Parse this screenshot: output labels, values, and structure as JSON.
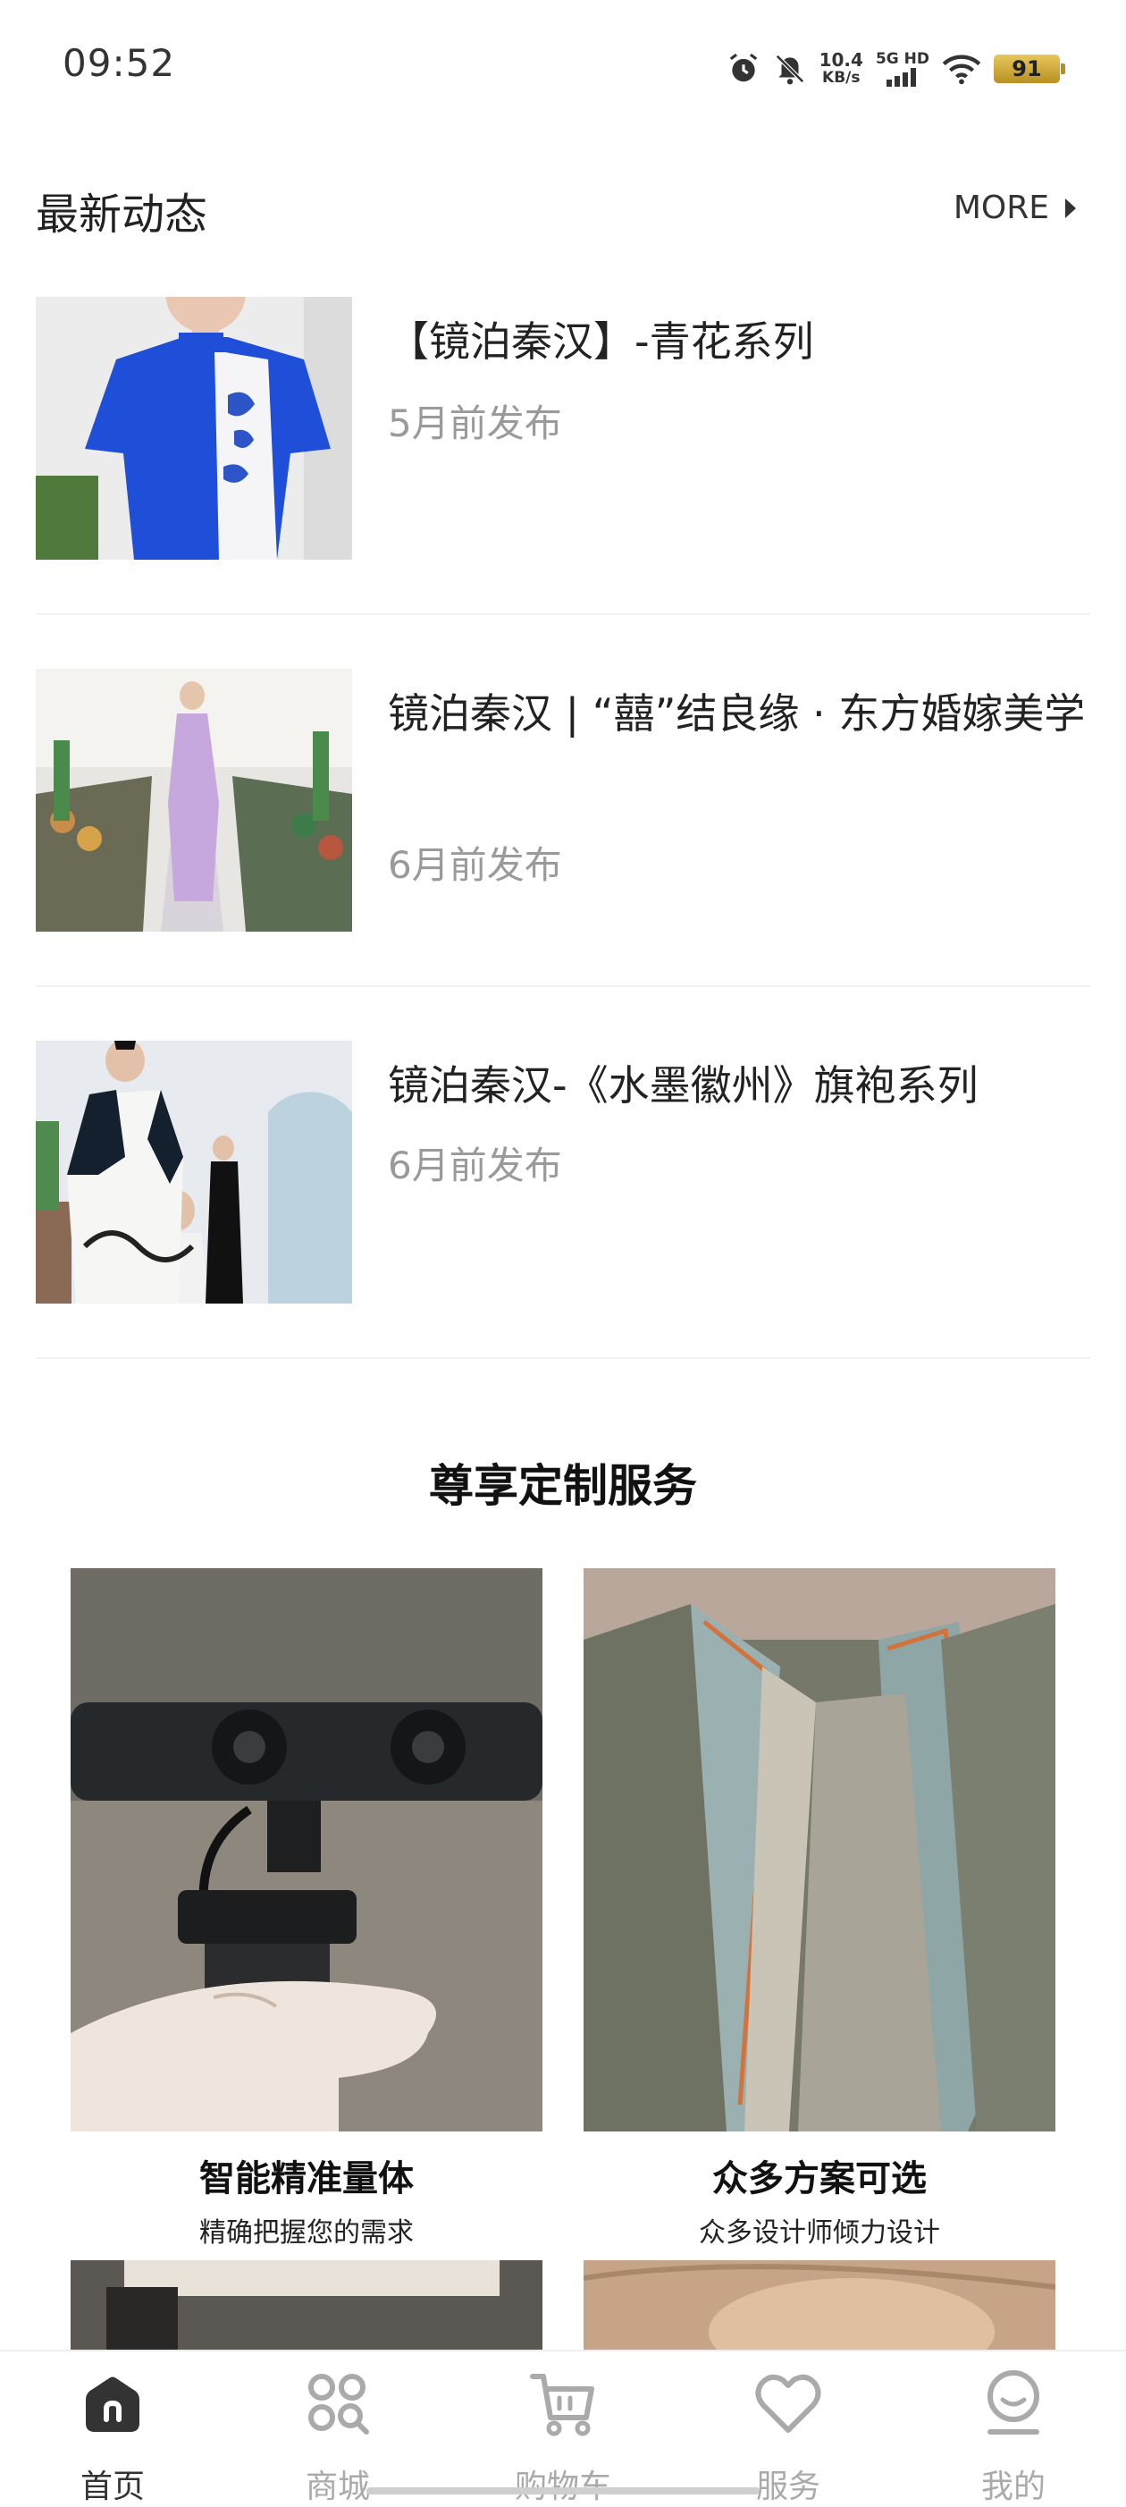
{
  "status_bar": {
    "time": "09:52",
    "net_speed_value": "10.4",
    "net_speed_unit": "KB/s",
    "signal": "5G HD",
    "battery": "91",
    "icons": [
      "alarm-icon",
      "mute-icon",
      "signal-icon",
      "wifi-icon",
      "battery-icon"
    ]
  },
  "news_section": {
    "title": "最新动态",
    "more_label": "MORE",
    "items": [
      {
        "title": "【镜泊秦汉】-青花系列",
        "time": "5月前发布"
      },
      {
        "title": "镜泊秦汉 | “囍”结良缘 · 东方婚嫁美学",
        "time": "6月前发布"
      },
      {
        "title": "镜泊秦汉-《水墨徽州》旗袍系列",
        "time": "6月前发布"
      }
    ]
  },
  "services": {
    "heading": "尊享定制服务",
    "cards": [
      {
        "title": "智能精准量体",
        "subtitle": "精确把握您的需求"
      },
      {
        "title": "众多方案可选",
        "subtitle": "众多设计师倾力设计"
      }
    ]
  },
  "tabbar": {
    "tabs": [
      {
        "label": "首页",
        "icon": "home-icon",
        "active": true
      },
      {
        "label": "商城",
        "icon": "mall-icon",
        "active": false
      },
      {
        "label": "购物车",
        "icon": "cart-icon",
        "active": false
      },
      {
        "label": "服务",
        "icon": "heart-icon",
        "active": false
      },
      {
        "label": "我的",
        "icon": "profile-icon",
        "active": false
      }
    ]
  },
  "colors": {
    "accent_text": "#222222",
    "muted_text": "#9a9a9a",
    "tab_inactive": "#aaaaaa"
  }
}
